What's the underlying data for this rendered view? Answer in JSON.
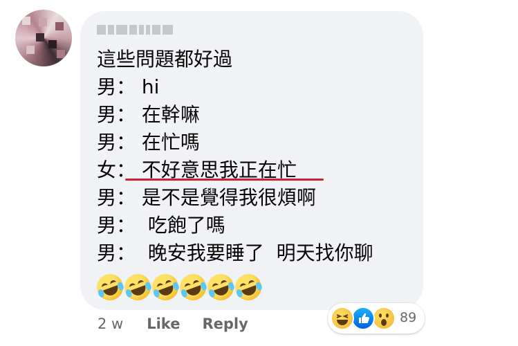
{
  "comment": {
    "author_name": "",
    "lines": [
      "這些問題都好過",
      "男： hi",
      "男： 在幹嘛",
      "男： 在忙嗎",
      "女： 不好意思我正在忙",
      "男： 是不是覺得我很煩啊",
      "男：  吃飽了嗎",
      "男：  晚安我要睡了  明天找你聊"
    ],
    "emoji_count": 6,
    "emoji_name": "rolling-on-floor-laughing",
    "highlight_color": "#d0202e"
  },
  "footer": {
    "time": "2 w",
    "like_label": "Like",
    "reply_label": "Reply"
  },
  "reactions": {
    "icons": [
      "haha",
      "like",
      "wow"
    ],
    "count": "89"
  }
}
